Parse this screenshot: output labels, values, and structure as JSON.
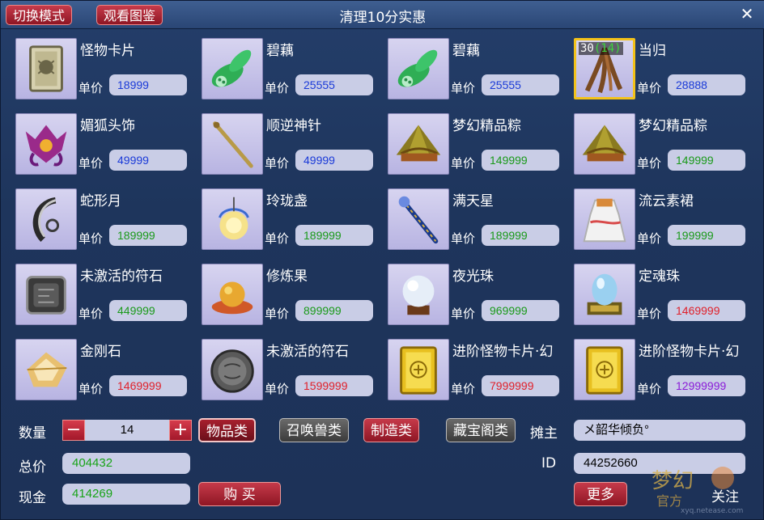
{
  "header": {
    "switch_mode": "切换模式",
    "view_catalog": "观看图鉴",
    "title": "清理10分实惠",
    "close": "✕"
  },
  "price_label": "单价",
  "items": [
    {
      "name": "怪物卡片",
      "price": "18999",
      "color": "#1a3ad8",
      "icon": "monster-card-icon"
    },
    {
      "name": "碧藕",
      "price": "25555",
      "color": "#1a3ad8",
      "icon": "lotus-root-icon"
    },
    {
      "name": "碧藕",
      "price": "25555",
      "color": "#1a3ad8",
      "icon": "lotus-root-icon"
    },
    {
      "name": "当归",
      "price": "28888",
      "color": "#1a3ad8",
      "icon": "angelica-root-icon",
      "qty": "30",
      "qty_inner": "(14)",
      "selected": true
    },
    {
      "name": "媚狐头饰",
      "price": "49999",
      "color": "#1a3ad8",
      "icon": "fox-headdress-icon"
    },
    {
      "name": "顺逆神针",
      "price": "49999",
      "color": "#1a3ad8",
      "icon": "needle-icon"
    },
    {
      "name": "梦幻精品粽",
      "price": "149999",
      "color": "#1a9a1a",
      "icon": "zongzi-icon"
    },
    {
      "name": "梦幻精品粽",
      "price": "149999",
      "color": "#1a9a1a",
      "icon": "zongzi-icon"
    },
    {
      "name": "蛇形月",
      "price": "189999",
      "color": "#1a9a1a",
      "icon": "snake-moon-icon"
    },
    {
      "name": "玲珑盏",
      "price": "189999",
      "color": "#1a9a1a",
      "icon": "lantern-icon"
    },
    {
      "name": "满天星",
      "price": "189999",
      "color": "#1a9a1a",
      "icon": "star-staff-icon"
    },
    {
      "name": "流云素裙",
      "price": "199999",
      "color": "#1a9a1a",
      "icon": "cloud-dress-icon"
    },
    {
      "name": "未激活的符石",
      "price": "449999",
      "color": "#1a9a1a",
      "icon": "rune-stone-icon"
    },
    {
      "name": "修炼果",
      "price": "899999",
      "color": "#1a9a1a",
      "icon": "training-fruit-icon"
    },
    {
      "name": "夜光珠",
      "price": "969999",
      "color": "#1a9a1a",
      "icon": "night-pearl-icon"
    },
    {
      "name": "定魂珠",
      "price": "1469999",
      "color": "#e0202a",
      "icon": "soul-pearl-icon"
    },
    {
      "name": "金刚石",
      "price": "1469999",
      "color": "#e0202a",
      "icon": "diamond-icon"
    },
    {
      "name": "未激活的符石",
      "price": "1599999",
      "color": "#e0202a",
      "icon": "round-rune-stone-icon"
    },
    {
      "name": "进阶怪物卡片·幻",
      "price": "7999999",
      "color": "#e0202a",
      "icon": "advanced-monster-card-icon"
    },
    {
      "name": "进阶怪物卡片·幻",
      "price": "12999999",
      "color": "#8a1ad8",
      "icon": "advanced-monster-card-icon"
    }
  ],
  "footer": {
    "quantity_label": "数量",
    "minus": "−",
    "quantity": "14",
    "plus": "+",
    "tabs": [
      "物品类",
      "召唤兽类",
      "制造类",
      "藏宝阁类"
    ],
    "owner_label": "摊主",
    "owner": "メ韶华倾负°",
    "total_label": "总价",
    "total": "404432",
    "id_label": "ID",
    "id": "44252660",
    "cash_label": "现金",
    "cash": "414269",
    "buy": "购 买",
    "more": "更多",
    "follow": "关注",
    "watermark_url": "xyq.netease.com"
  },
  "colors": {
    "price_green": "#1a9a1a",
    "price_blue": "#1a3ad8",
    "price_red": "#e0202a",
    "price_purple": "#8a1ad8",
    "field_green": "#17a317"
  }
}
